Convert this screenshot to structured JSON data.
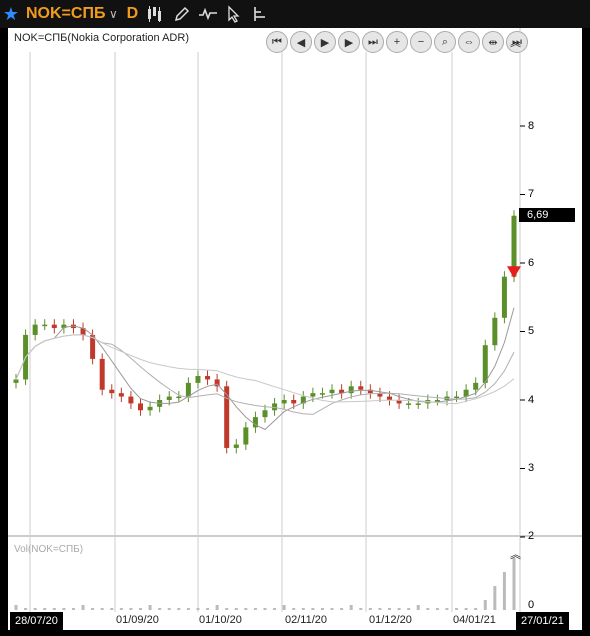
{
  "toolbar": {
    "symbol": "NOK=СПБ",
    "dropdown_glyph": "∨",
    "period": "D",
    "icons": [
      "candlestick-chart-icon",
      "pencil-icon",
      "indicator-icon",
      "cursor-icon",
      "layout-icon"
    ]
  },
  "main": {
    "title": "NOK=СПБ(Nokia Corporation ADR)",
    "price_badge": "6,69",
    "y_ticks": [
      "8",
      "7",
      "6",
      "5",
      "4",
      "3",
      "2"
    ],
    "nav_buttons": [
      "⏮",
      "◀",
      "▶",
      "▶",
      "⏭",
      "+",
      "−",
      "⌕",
      "⇔",
      "⇹",
      "⏭"
    ]
  },
  "volume": {
    "title": "Vol(NOK=СПБ)",
    "y_tick": "0"
  },
  "x_axis": {
    "start_tag": "28/07/20",
    "end_tag": "27/01/21",
    "labels": [
      "01/09/20",
      "01/10/20",
      "02/11/20",
      "01/12/20",
      "04/01/21"
    ]
  },
  "colors": {
    "up": "#5a8f29",
    "down": "#c0392b",
    "accent": "#f19c1d",
    "star": "#2d8cff",
    "signal": "#e81e1e"
  },
  "chart_data": {
    "type": "candlestick",
    "ylim": [
      2,
      8.9
    ],
    "y_ticks": [
      8,
      7,
      6,
      5,
      4,
      3,
      2
    ],
    "last_price": 6.69,
    "ma_lines": 3,
    "x": [
      "28/07/20",
      "01/09/20",
      "01/10/20",
      "02/11/20",
      "01/12/20",
      "04/01/21",
      "27/01/21"
    ],
    "close": [
      4.3,
      4.95,
      5.1,
      5.1,
      5.05,
      5.1,
      5.05,
      4.95,
      4.6,
      4.15,
      4.1,
      4.05,
      3.95,
      3.85,
      3.9,
      4.0,
      4.05,
      4.05,
      4.25,
      4.35,
      4.3,
      4.2,
      3.3,
      3.35,
      3.6,
      3.75,
      3.85,
      3.95,
      4.0,
      3.95,
      4.05,
      4.1,
      4.1,
      4.15,
      4.1,
      4.2,
      4.15,
      4.1,
      4.05,
      4.0,
      3.95,
      3.95,
      3.95,
      4.0,
      4.0,
      4.05,
      4.05,
      4.15,
      4.25,
      4.8,
      5.2,
      5.8,
      6.69
    ]
  }
}
